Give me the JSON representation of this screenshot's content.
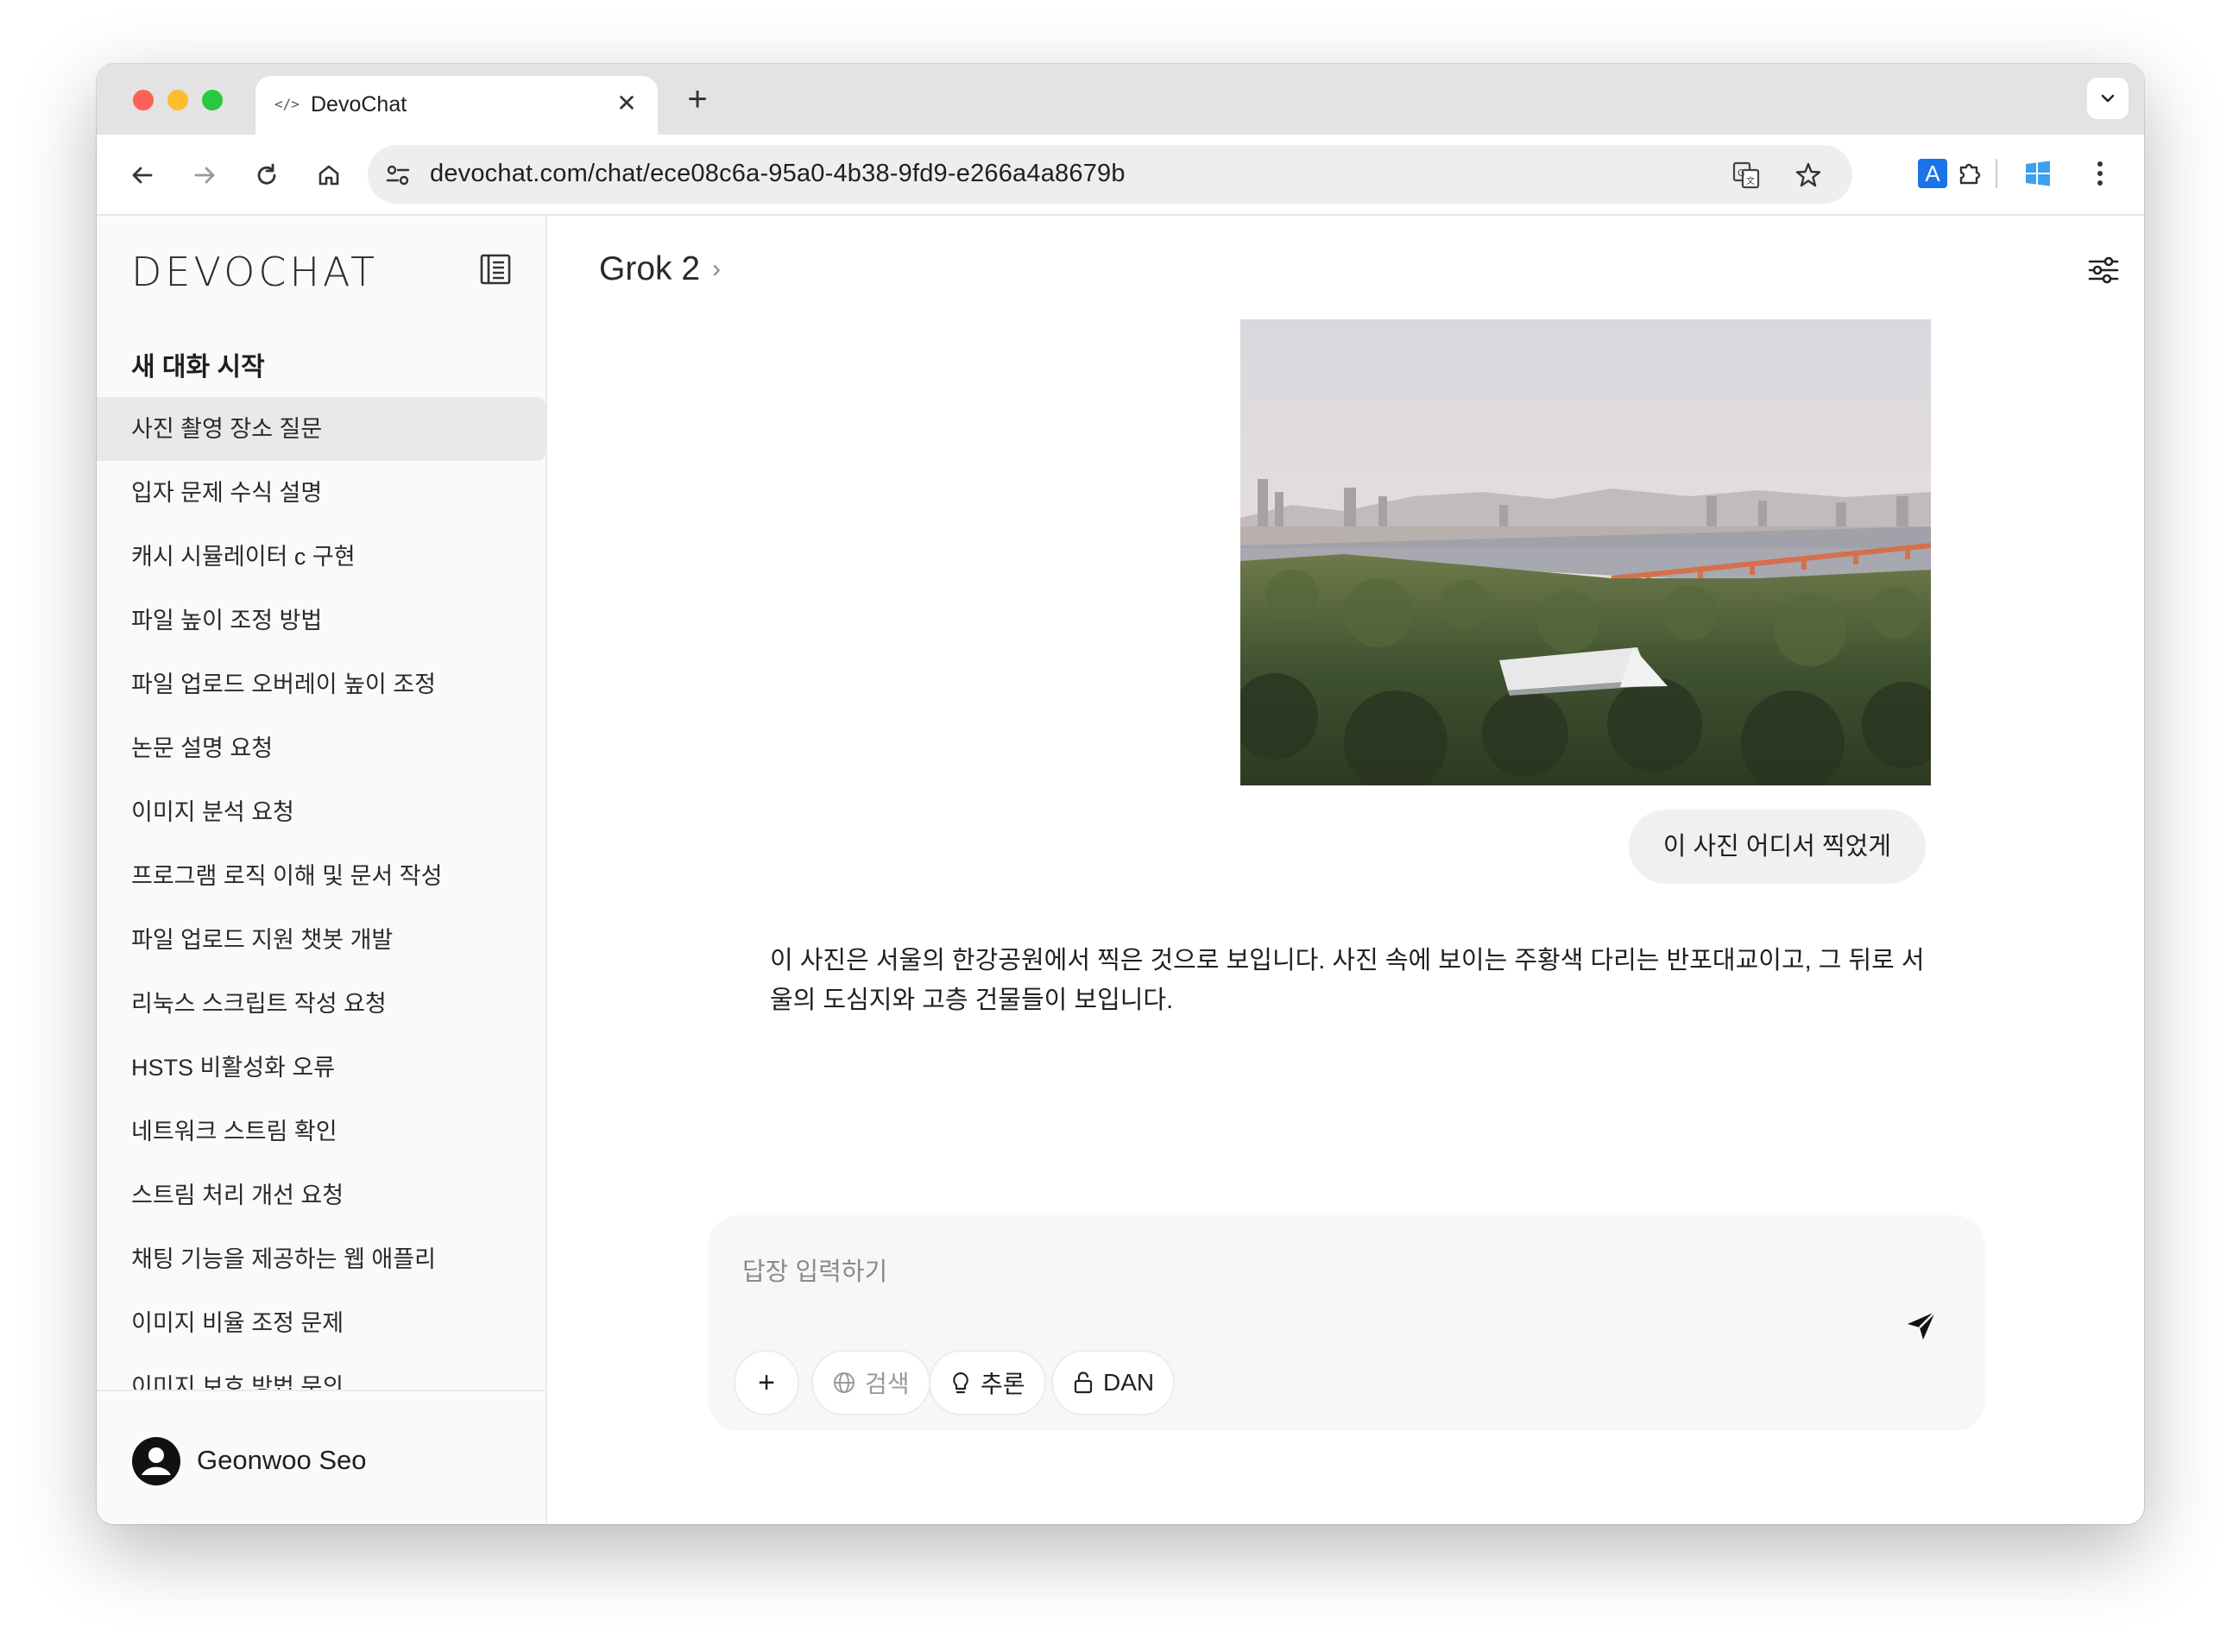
{
  "browser": {
    "tab_title": "DevoChat",
    "tab_favicon": "</>",
    "tab_close": "✕",
    "new_tab": "+",
    "url": "devochat.com/chat/ece08c6a-95a0-4b38-9fd9-e266a4a8679b",
    "extensions": [
      "translate-icon",
      "star-icon",
      "a-extension-icon",
      "puzzle-icon",
      "windows-icon",
      "kebab-menu-icon"
    ],
    "ext_a_label": "A"
  },
  "sidebar": {
    "logo": "DEVOCHAT",
    "new_chat": "새 대화 시작",
    "items": [
      {
        "label": "사진 촬영 장소 질문",
        "active": true
      },
      {
        "label": "입자 문제 수식 설명"
      },
      {
        "label": "캐시 시뮬레이터 c 구현"
      },
      {
        "label": "파일 높이 조정 방법"
      },
      {
        "label": "파일 업로드 오버레이 높이 조정"
      },
      {
        "label": "논문 설명 요청"
      },
      {
        "label": "이미지 분석 요청"
      },
      {
        "label": "프로그램 로직 이해 및 문서 작성"
      },
      {
        "label": "파일 업로드 지원 챗봇 개발"
      },
      {
        "label": "리눅스 스크립트 작성 요청"
      },
      {
        "label": "HSTS 비활성화 오류"
      },
      {
        "label": "네트워크 스트림 확인"
      },
      {
        "label": "스트림 처리 개선 요청"
      },
      {
        "label": "채팅 기능을 제공하는 웹 애플리"
      },
      {
        "label": "이미지 비율 조정 문제"
      },
      {
        "label": "이미지 보호 방법 문의"
      }
    ],
    "user_name": "Geonwoo Seo"
  },
  "main": {
    "model_name": "Grok 2",
    "model_chevron": "›",
    "user_message": "이 사진 어디서 찍었게",
    "assistant_message": "이 사진은 서울의 한강공원에서 찍은 것으로 보입니다. 사진 속에 보이는 주황색 다리는 반포대교이고, 그 뒤로 서울의 도심지와 고층 건물들이 보입니다.",
    "composer": {
      "placeholder": "답장 입력하기",
      "plus": "+",
      "chips": {
        "search": "검색",
        "reason": "추론",
        "dan": "DAN"
      }
    }
  },
  "colors": {
    "accent_blue": "#1a73e8",
    "windows_blue": "#3ba0f0",
    "sidebar_active": "#e9e9e9"
  }
}
